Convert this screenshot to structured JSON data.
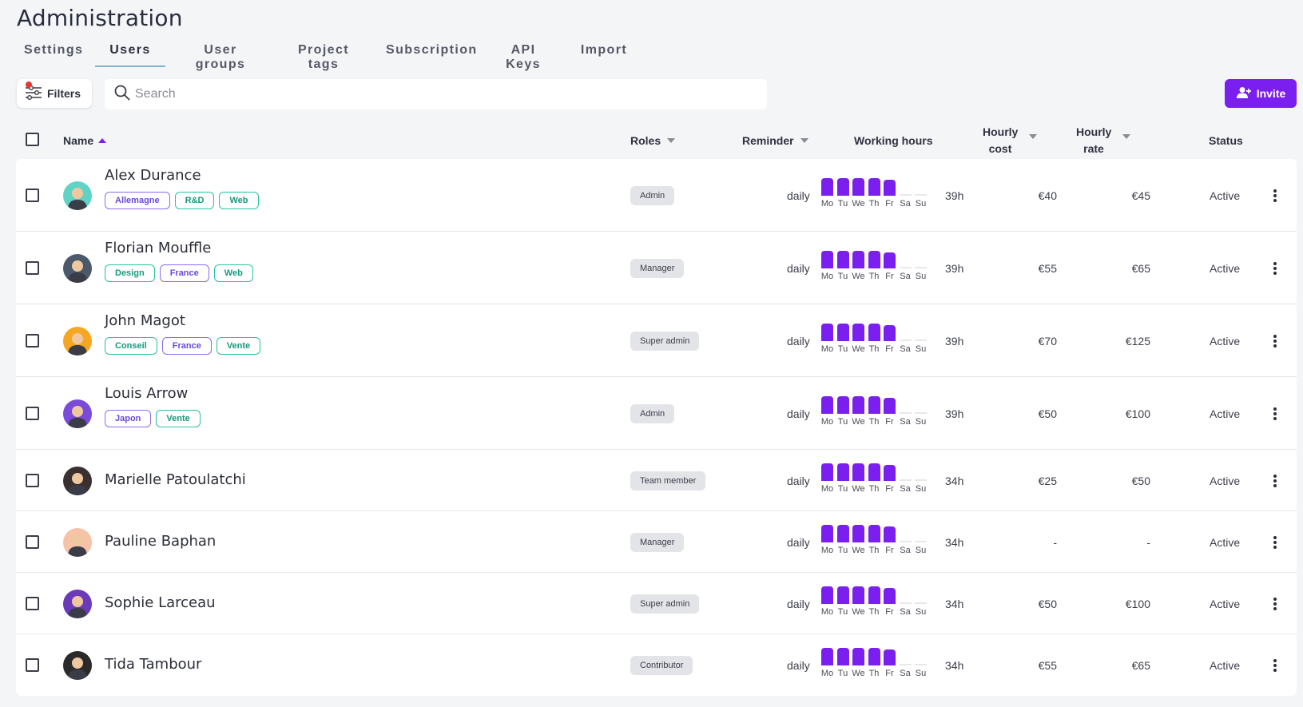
{
  "page": {
    "title": "Administration"
  },
  "tabs": [
    {
      "label": "Settings",
      "active": false
    },
    {
      "label": "Users",
      "active": true
    },
    {
      "label": "User groups",
      "active": false
    },
    {
      "label": "Project tags",
      "active": false
    },
    {
      "label": "Subscription",
      "active": false
    },
    {
      "label": "API Keys",
      "active": false
    },
    {
      "label": "Import",
      "active": false
    }
  ],
  "toolbar": {
    "filters_label": "Filters",
    "search_placeholder": "Search",
    "invite_label": "Invite"
  },
  "columns": {
    "name": "Name",
    "roles": "Roles",
    "reminder": "Reminder",
    "working_hours": "Working hours",
    "hourly_cost_line1": "Hourly",
    "hourly_cost_line2": "cost",
    "hourly_rate_line1": "Hourly",
    "hourly_rate_line2": "rate",
    "status": "Status"
  },
  "days": [
    "Mo",
    "Tu",
    "We",
    "Th",
    "Fr",
    "Sa",
    "Su"
  ],
  "colors": {
    "accent": "#7a1ff0",
    "tag_purple": "#8c6cf0",
    "tag_teal": "#26c2a0"
  },
  "users": [
    {
      "name": "Alex Durance",
      "tags": [
        {
          "label": "Allemagne",
          "color": "purple"
        },
        {
          "label": "R&D",
          "color": "teal"
        },
        {
          "label": "Web",
          "color": "teal"
        }
      ],
      "role": "Admin",
      "reminder": "daily",
      "hours": "39h",
      "hourly_cost": "€40",
      "hourly_rate": "€45",
      "status": "Active",
      "avatar_color": "#5fd3c6",
      "day_hours": [
        8,
        8,
        8,
        8,
        7,
        0,
        0
      ]
    },
    {
      "name": "Florian Mouffle",
      "tags": [
        {
          "label": "Design",
          "color": "teal"
        },
        {
          "label": "France",
          "color": "purple"
        },
        {
          "label": "Web",
          "color": "teal"
        }
      ],
      "role": "Manager",
      "reminder": "daily",
      "hours": "39h",
      "hourly_cost": "€55",
      "hourly_rate": "€65",
      "status": "Active",
      "avatar_color": "#4a5a6a",
      "day_hours": [
        8,
        8,
        8,
        8,
        7,
        0,
        0
      ]
    },
    {
      "name": "John Magot",
      "tags": [
        {
          "label": "Conseil",
          "color": "teal"
        },
        {
          "label": "France",
          "color": "purple"
        },
        {
          "label": "Vente",
          "color": "teal"
        }
      ],
      "role": "Super admin",
      "reminder": "daily",
      "hours": "39h",
      "hourly_cost": "€70",
      "hourly_rate": "€125",
      "status": "Active",
      "avatar_color": "#f5a623",
      "day_hours": [
        8,
        8,
        8,
        8,
        7,
        0,
        0
      ]
    },
    {
      "name": "Louis Arrow",
      "tags": [
        {
          "label": "Japon",
          "color": "purple"
        },
        {
          "label": "Vente",
          "color": "teal"
        }
      ],
      "role": "Admin",
      "reminder": "daily",
      "hours": "39h",
      "hourly_cost": "€50",
      "hourly_rate": "€100",
      "status": "Active",
      "avatar_color": "#7a4ad8",
      "day_hours": [
        8,
        8,
        8,
        8,
        7,
        0,
        0
      ]
    },
    {
      "name": "Marielle Patoulatchi",
      "tags": [],
      "role": "Team member",
      "reminder": "daily",
      "hours": "34h",
      "hourly_cost": "€25",
      "hourly_rate": "€50",
      "status": "Active",
      "avatar_color": "#3a3030",
      "day_hours": [
        8,
        8,
        8,
        8,
        7,
        0,
        0
      ]
    },
    {
      "name": "Pauline Baphan",
      "tags": [],
      "role": "Manager",
      "reminder": "daily",
      "hours": "34h",
      "hourly_cost": "-",
      "hourly_rate": "-",
      "status": "Active",
      "avatar_color": "#f6c2a8",
      "day_hours": [
        8,
        8,
        8,
        8,
        7,
        0,
        0
      ]
    },
    {
      "name": "Sophie Larceau",
      "tags": [],
      "role": "Super admin",
      "reminder": "daily",
      "hours": "34h",
      "hourly_cost": "€50",
      "hourly_rate": "€100",
      "status": "Active",
      "avatar_color": "#6a3ab8",
      "day_hours": [
        8,
        8,
        8,
        8,
        7,
        0,
        0
      ]
    },
    {
      "name": "Tida Tambour",
      "tags": [],
      "role": "Contributor",
      "reminder": "daily",
      "hours": "34h",
      "hourly_cost": "€55",
      "hourly_rate": "€65",
      "status": "Active",
      "avatar_color": "#2a2a2a",
      "day_hours": [
        8,
        8,
        8,
        8,
        7,
        0,
        0
      ]
    }
  ]
}
